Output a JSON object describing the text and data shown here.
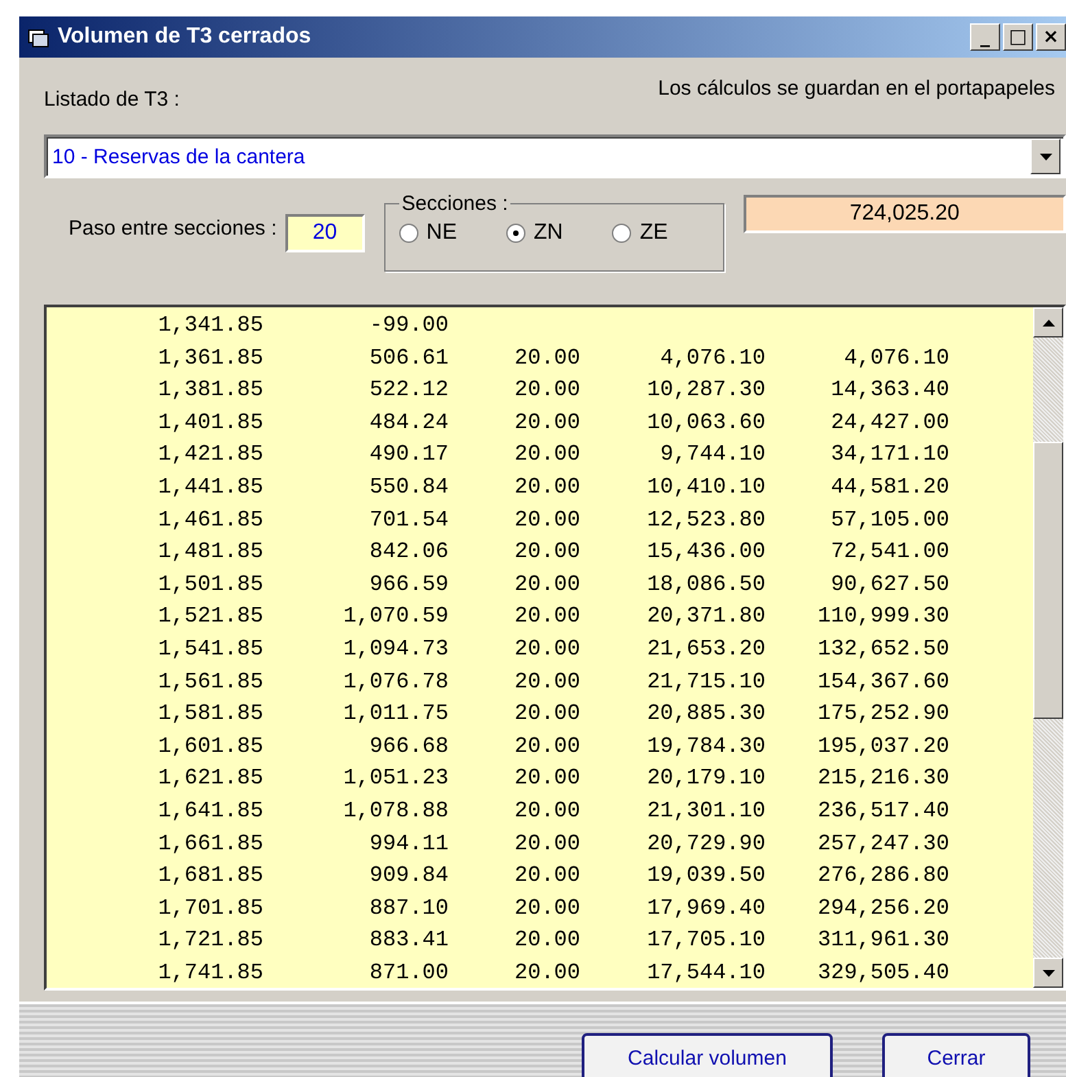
{
  "window": {
    "title": "Volumen de T3 cerrados",
    "controls": [
      "_",
      "□",
      "×"
    ]
  },
  "list_label": "Listado de T3 :",
  "clipboard_note": "Los cálculos se guardan en el portapapeles",
  "t3_select": {
    "value": "10 - Reservas de la cantera"
  },
  "step": {
    "label": "Paso entre secciones :",
    "value": "20"
  },
  "sections": {
    "legend": "Secciones :",
    "options": [
      {
        "label": "NE",
        "selected": false
      },
      {
        "label": "ZN",
        "selected": true
      },
      {
        "label": "ZE",
        "selected": false
      }
    ]
  },
  "total": "724,025.20",
  "rows": [
    [
      "1,341.85",
      "-99.00"
    ],
    [
      "1,361.85",
      "506.61",
      "20.00",
      "4,076.10",
      "4,076.10"
    ],
    [
      "1,381.85",
      "522.12",
      "20.00",
      "10,287.30",
      "14,363.40"
    ],
    [
      "1,401.85",
      "484.24",
      "20.00",
      "10,063.60",
      "24,427.00"
    ],
    [
      "1,421.85",
      "490.17",
      "20.00",
      "9,744.10",
      "34,171.10"
    ],
    [
      "1,441.85",
      "550.84",
      "20.00",
      "10,410.10",
      "44,581.20"
    ],
    [
      "1,461.85",
      "701.54",
      "20.00",
      "12,523.80",
      "57,105.00"
    ],
    [
      "1,481.85",
      "842.06",
      "20.00",
      "15,436.00",
      "72,541.00"
    ],
    [
      "1,501.85",
      "966.59",
      "20.00",
      "18,086.50",
      "90,627.50"
    ],
    [
      "1,521.85",
      "1,070.59",
      "20.00",
      "20,371.80",
      "110,999.30"
    ],
    [
      "1,541.85",
      "1,094.73",
      "20.00",
      "21,653.20",
      "132,652.50"
    ],
    [
      "1,561.85",
      "1,076.78",
      "20.00",
      "21,715.10",
      "154,367.60"
    ],
    [
      "1,581.85",
      "1,011.75",
      "20.00",
      "20,885.30",
      "175,252.90"
    ],
    [
      "1,601.85",
      "966.68",
      "20.00",
      "19,784.30",
      "195,037.20"
    ],
    [
      "1,621.85",
      "1,051.23",
      "20.00",
      "20,179.10",
      "215,216.30"
    ],
    [
      "1,641.85",
      "1,078.88",
      "20.00",
      "21,301.10",
      "236,517.40"
    ],
    [
      "1,661.85",
      "994.11",
      "20.00",
      "20,729.90",
      "257,247.30"
    ],
    [
      "1,681.85",
      "909.84",
      "20.00",
      "19,039.50",
      "276,286.80"
    ],
    [
      "1,701.85",
      "887.10",
      "20.00",
      "17,969.40",
      "294,256.20"
    ],
    [
      "1,721.85",
      "883.41",
      "20.00",
      "17,705.10",
      "311,961.30"
    ],
    [
      "1,741.85",
      "871.00",
      "20.00",
      "17,544.10",
      "329,505.40"
    ]
  ],
  "buttons": [
    "Calcular volumen",
    "Cerrar"
  ]
}
